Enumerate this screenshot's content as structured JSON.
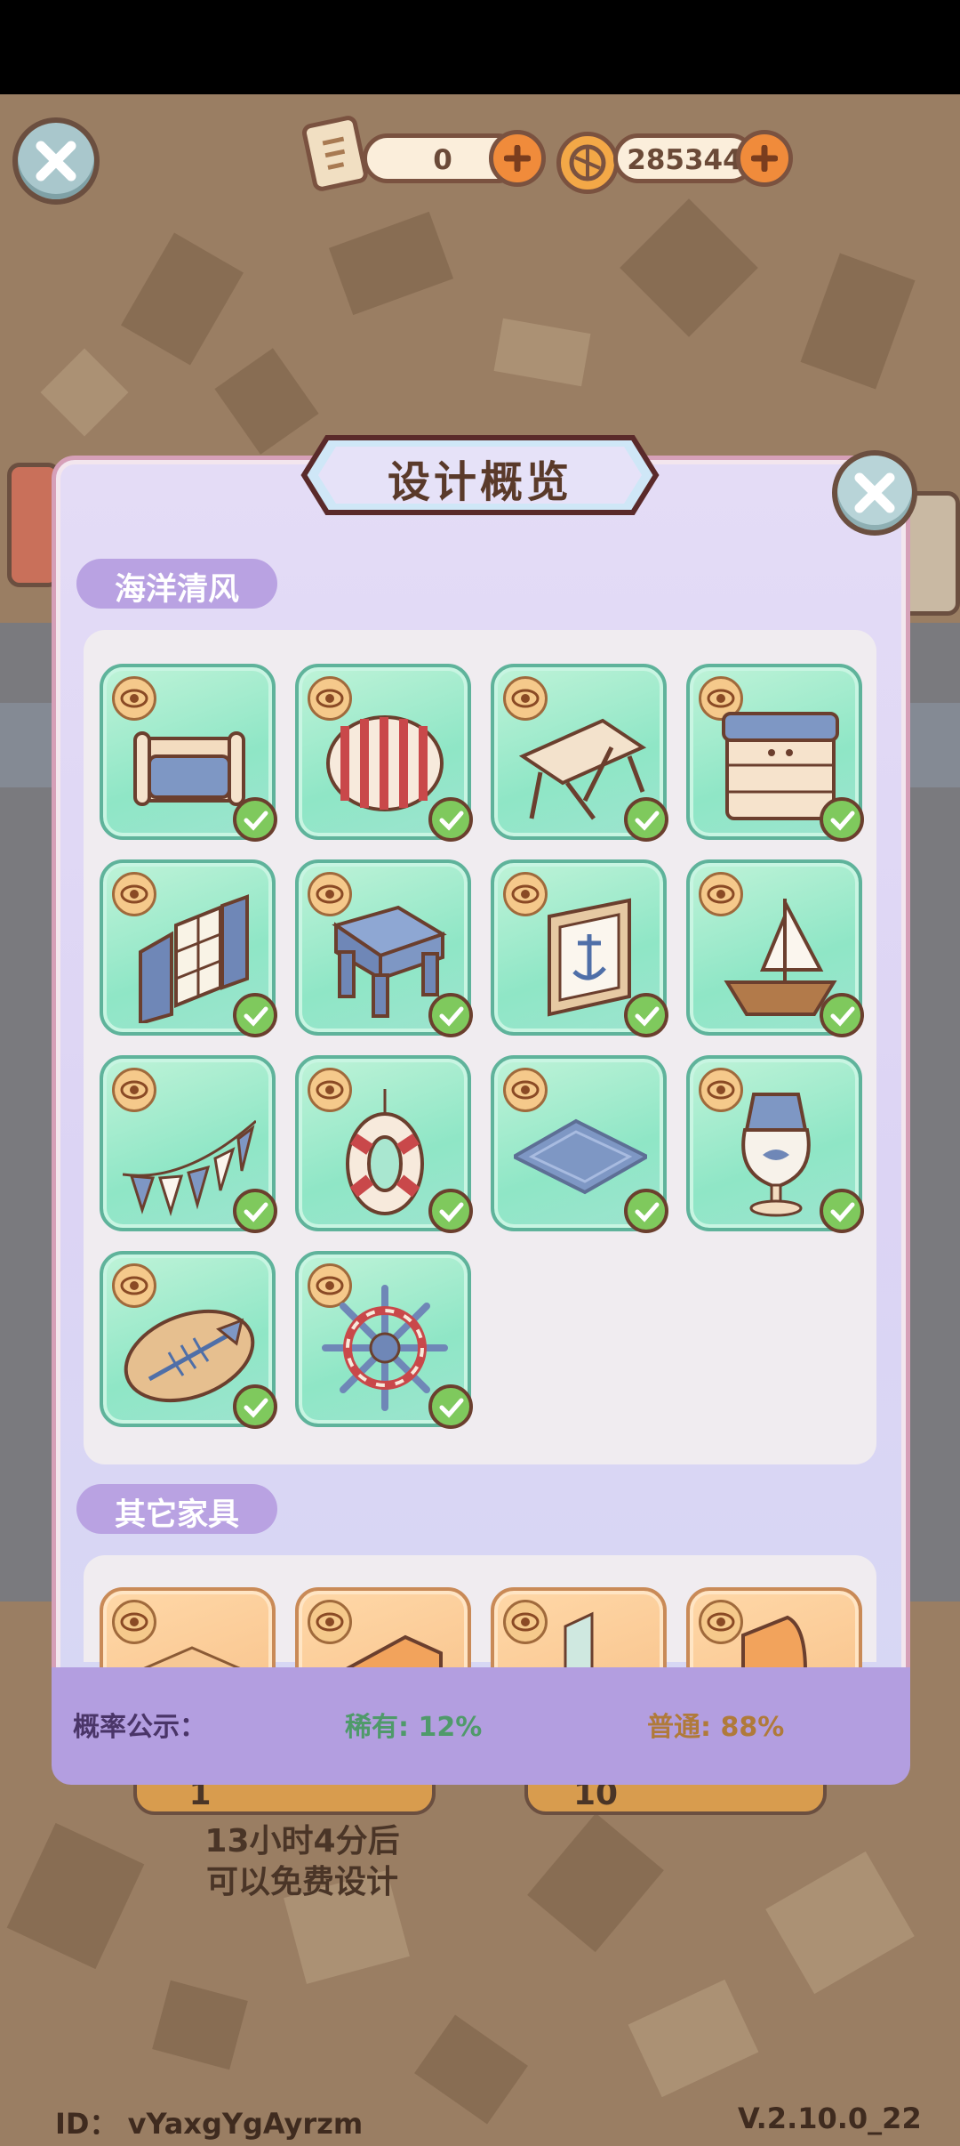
{
  "currency": {
    "scroll_amount": "0",
    "coin_amount": "285344",
    "scroll_icon": "scroll-icon",
    "coin_icon": "coin-icon"
  },
  "dialog": {
    "title": "设计概览",
    "section1_label": "海洋清风",
    "section2_label": "其它家具",
    "items": [
      {
        "icon": "sofa-icon",
        "owned": true
      },
      {
        "icon": "striped-cushion-icon",
        "owned": true
      },
      {
        "icon": "table-icon",
        "owned": true
      },
      {
        "icon": "drawer-cabinet-icon",
        "owned": true
      },
      {
        "icon": "window-shutter-icon",
        "owned": true
      },
      {
        "icon": "stool-icon",
        "owned": true
      },
      {
        "icon": "anchor-frame-icon",
        "owned": true
      },
      {
        "icon": "sailboat-icon",
        "owned": true
      },
      {
        "icon": "bunting-icon",
        "owned": true
      },
      {
        "icon": "life-ring-icon",
        "owned": true
      },
      {
        "icon": "rug-icon",
        "owned": true
      },
      {
        "icon": "fish-lamp-icon",
        "owned": true
      },
      {
        "icon": "fish-bone-plaque-icon",
        "owned": true
      },
      {
        "icon": "ship-wheel-icon",
        "owned": true
      }
    ],
    "probability_label": "概率公示：",
    "rare_label": "稀有: 12%",
    "common_label": "普通: 88%"
  },
  "background": {
    "count_1": "1",
    "count_10": "10",
    "timer_line1": "13小时4分后",
    "timer_line2": "可以免费设计"
  },
  "footer": {
    "id_text": "ID：  vYaxgYgAyrzm",
    "version_text": "V.2.10.0_22"
  },
  "colors": {
    "rare": "#4f9a6a",
    "common": "#b07a3a",
    "accent": "#f08b3b"
  }
}
